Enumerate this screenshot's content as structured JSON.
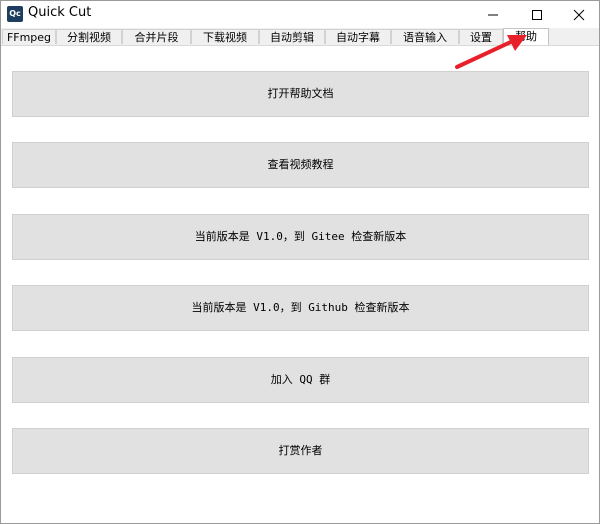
{
  "window": {
    "app_icon_text": "Qc",
    "title": "Quick Cut"
  },
  "tabs": [
    {
      "label": "FFmpeg"
    },
    {
      "label": "分割视频"
    },
    {
      "label": "合并片段"
    },
    {
      "label": "下载视频"
    },
    {
      "label": "自动剪辑"
    },
    {
      "label": "自动字幕"
    },
    {
      "label": "语音输入"
    },
    {
      "label": "设置"
    },
    {
      "label": "帮助",
      "selected": true
    }
  ],
  "help_panel": {
    "buttons": [
      {
        "label": "打开帮助文档"
      },
      {
        "label": "查看视频教程"
      },
      {
        "label": "当前版本是 V1.0，到 Gitee 检查新版本"
      },
      {
        "label": "当前版本是 V1.0，到 Github 检查新版本"
      },
      {
        "label": "加入 QQ 群"
      },
      {
        "label": "打赏作者"
      }
    ]
  },
  "icons": {
    "app": "app-icon",
    "minimize": "minimize-icon",
    "maximize": "maximize-icon",
    "close": "close-icon",
    "annotation": "red-arrow-icon"
  },
  "colors": {
    "annotation_arrow": "#e8202a",
    "app_icon_bg": "#1d3e5e",
    "button_bg": "#e1e1e1"
  }
}
